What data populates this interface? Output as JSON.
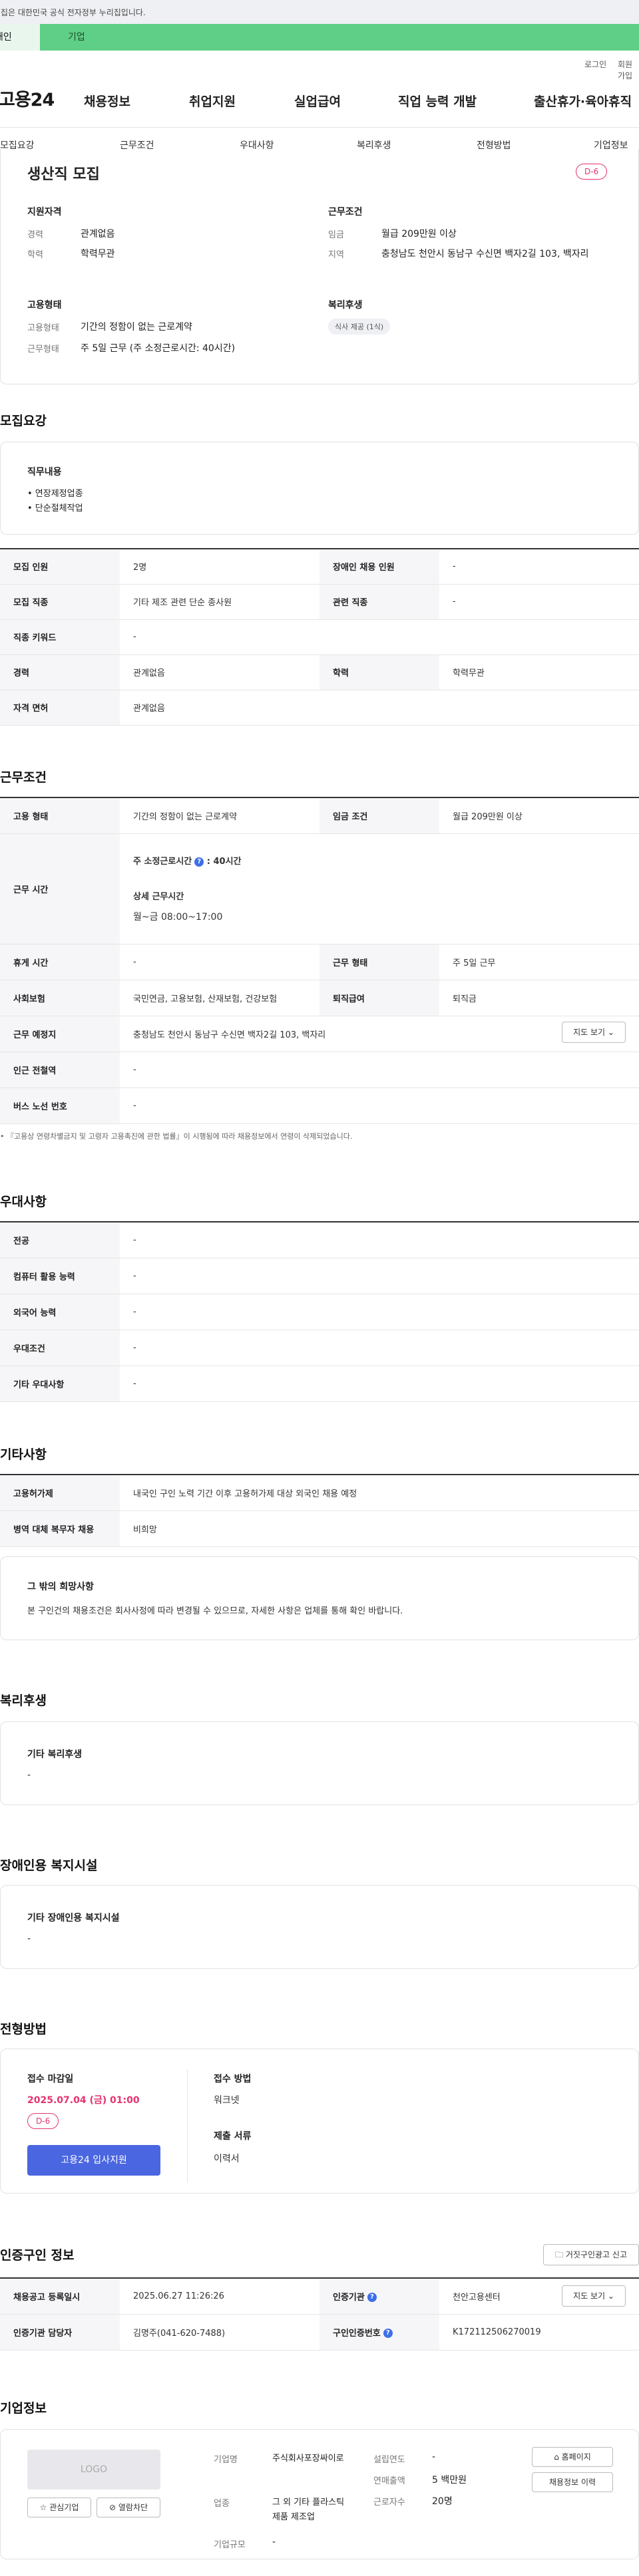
{
  "top": {
    "gov_notice": "이 누리집은 대한민국 공식 전자정부 누리집입니다.",
    "tab_personal": "개인",
    "tab_business": "기업",
    "login": "로그인",
    "join": "회원가입"
  },
  "gnb": {
    "logo": "고용24",
    "menu": [
      "채용정보",
      "취업지원",
      "실업급여",
      "직업 능력 개발",
      "출산휴가·육아휴직"
    ]
  },
  "subnav": [
    "모집요강",
    "근무조건",
    "우대사항",
    "복리후생",
    "전형방법",
    "기업정보"
  ],
  "summary": {
    "title": "생산직 모집",
    "dday": "D-6",
    "qual_head": "지원자격",
    "career_label": "경력",
    "career_value": "관계없음",
    "edu_label": "학력",
    "edu_value": "학력무관",
    "cond_head": "근무조건",
    "wage_label": "임금",
    "wage_value": "월급 209만원 이상",
    "region_label": "지역",
    "region_value": "충청남도 천안시 동남구 수신면 백자2길 103, 백자리",
    "emp_head": "고용형태",
    "type_label": "고용형태",
    "type_value": "기간의 정함이 없는 근로계약",
    "work_label": "근무형태",
    "work_value": "주 5일 근무 (주 소정근로시간: 40시간)",
    "welfare_head": "복리후생",
    "welfare_chip": "식사 제공 (1식)"
  },
  "recruit": {
    "title": "모집요강",
    "duty_head": "직무내용",
    "duties": [
      "• 연장제정업종",
      "• 단순절체작업"
    ],
    "rows": {
      "count_h": "모집 인원",
      "count_v": "2명",
      "disabled_h": "장애인 채용 인원",
      "disabled_v": "-",
      "job_h": "모집 직종",
      "job_v": "기타 제조 관련 단순 종사원",
      "related_h": "관련 직종",
      "related_v": "-",
      "keyword_h": "직종 키워드",
      "keyword_v": "-",
      "career_h": "경력",
      "career_v": "관계없음",
      "edu_h": "학력",
      "edu_v": "학력무관",
      "license_h": "자격 면허",
      "license_v": "관계없음"
    }
  },
  "work": {
    "title": "근무조건",
    "type_h": "고용 형태",
    "type_v": "기간의 정함이 없는 근로계약",
    "wage_h": "임금 조건",
    "wage_v": "월급 209만원 이상",
    "hours_h": "근무 시간",
    "hours_sub1": "주 소정근로시간",
    "hours_sub1_val": ": 40시간",
    "hours_sub2": "상세 근무시간",
    "hours_sub2_val": "월~금 08:00~17:00",
    "rest_h": "휴게 시간",
    "rest_v": "-",
    "form_h": "근무 형태",
    "form_v": "주 5일 근무",
    "insurance_h": "사회보험",
    "insurance_v": "국민연금, 고용보험, 산재보험, 건강보험",
    "retire_h": "퇴직급여",
    "retire_v": "퇴직금",
    "place_h": "근무 예정지",
    "place_v": "충청남도 천안시 동남구 수신면 백자2길 103, 백자리",
    "map_btn": "지도 보기",
    "subway_h": "인근 전철역",
    "subway_v": "-",
    "bus_h": "버스 노선 번호",
    "bus_v": "-",
    "note": "• 『고용상 연령차별금지 및 고령자 고용촉진에 관한 법률』이 시행됨에 따라 채용정보에서 연령이 삭제되었습니다."
  },
  "prefer": {
    "title": "우대사항",
    "major_h": "전공",
    "major_v": "-",
    "computer_h": "컴퓨터 활용 능력",
    "computer_v": "-",
    "lang_h": "외국어 능력",
    "lang_v": "-",
    "cond_h": "우대조건",
    "cond_v": "-",
    "etc_h": "기타 우대사항",
    "etc_v": "-"
  },
  "etc": {
    "title": "기타사항",
    "permit_h": "고용허가제",
    "permit_v": "내국인 구인 노력 기간 이후 고용허가제 대상 외국인 채용 예정",
    "military_h": "병역 대체 복무자 채용",
    "military_v": "비희망",
    "extra_head": "그 밖의 희망사항",
    "extra_text": "본 구인건의 채용조건은 회사사정에 따라 변경될 수 있으므로, 자세한 사항은 업체를 통해 확인 바랍니다."
  },
  "welfare": {
    "title": "복리후생",
    "head": "기타 복리후생",
    "value": "-"
  },
  "disability": {
    "title": "장애인용 복지시설",
    "head": "기타 장애인용 복지시설",
    "value": "-"
  },
  "process": {
    "title": "전형방법",
    "deadline_head": "접수 마감일",
    "deadline": "2025.07.04 (금) 01:00",
    "dday": "D-6",
    "apply_btn": "고용24 입사지원",
    "method_head": "접수 방법",
    "method_value": "워크넷",
    "docs_head": "제출 서류",
    "docs_value": "이력서"
  },
  "cert": {
    "title": "인증구인 정보",
    "report_btn": "거짓구인광고 신고",
    "reg_h": "채용공고 등록일시",
    "reg_v": "2025.06.27 11:26:26",
    "agency_h": "인증기관",
    "agency_v": "천안고용센터",
    "map_btn": "지도 보기",
    "manager_h": "인증기관 담당자",
    "manager_v": "김명주(041-620-7488)",
    "number_h": "구인인증번호",
    "number_v": "K172112506270019"
  },
  "company": {
    "title": "기업정보",
    "logo": "LOGO",
    "interest_btn": "관심기업",
    "block_btn": "열람차단",
    "name_l": "기업명",
    "name_v": "주식회사포장싸이로",
    "industry_l": "업종",
    "industry_v": "그 외 기타 플라스틱 제품 제조업",
    "size_l": "기업규모",
    "size_v": "-",
    "year_l": "설립연도",
    "year_v": "-",
    "sales_l": "연매출액",
    "sales_v": "5 백만원",
    "staff_l": "근로자수",
    "staff_v": "20명",
    "homepage_btn": "홈페이지",
    "history_btn": "채용정보 이력"
  }
}
